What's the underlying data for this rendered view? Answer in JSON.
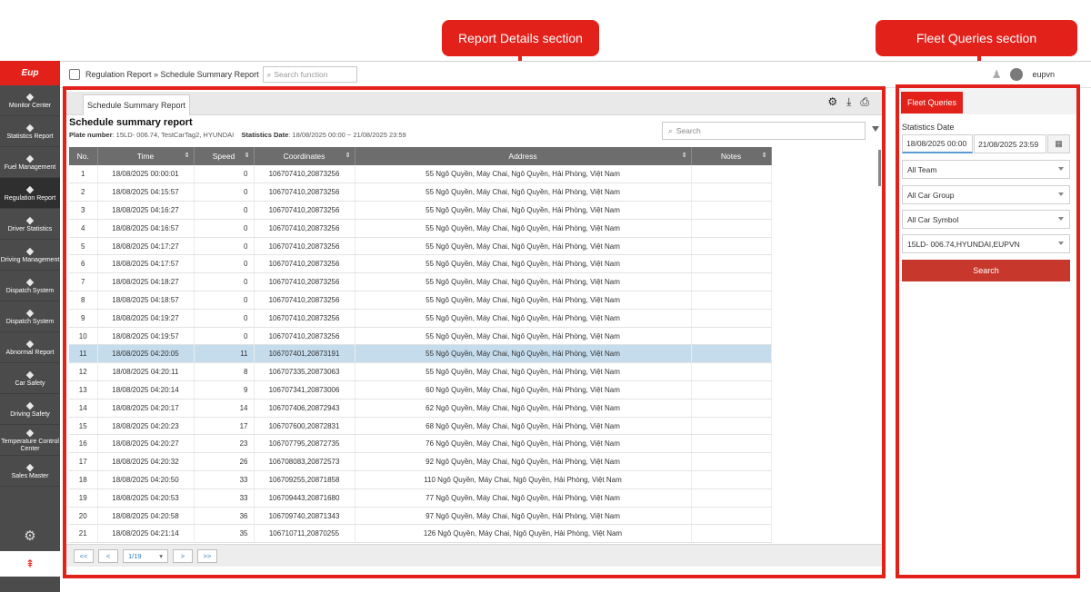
{
  "callouts": {
    "report_details": "Report Details section",
    "fleet_queries": "Fleet Queries section"
  },
  "sidebar": {
    "logo": "Eup",
    "items": [
      {
        "label": "Monitor Center",
        "icon": "monitor-icon"
      },
      {
        "label": "Statistics Report",
        "icon": "statistics-icon"
      },
      {
        "label": "Fuel Management",
        "icon": "fuel-icon"
      },
      {
        "label": "Regulation Report",
        "icon": "regulation-icon"
      },
      {
        "label": "Driver Statistics",
        "icon": "driver-icon"
      },
      {
        "label": "Driving Management",
        "icon": "driving-icon"
      },
      {
        "label": "Dispatch System",
        "icon": "dispatch-icon"
      },
      {
        "label": "Dispatch System",
        "icon": "dispatch-icon"
      },
      {
        "label": "Abnormal Report",
        "icon": "abnormal-icon"
      },
      {
        "label": "Car Safety",
        "icon": "car-safety-icon"
      },
      {
        "label": "Driving Safety",
        "icon": "driving-safety-icon"
      },
      {
        "label": "Temperature Control Center",
        "icon": "temperature-icon"
      },
      {
        "label": "Sales Master",
        "icon": "sales-icon"
      }
    ]
  },
  "topbar": {
    "breadcrumb": "Regulation Report » Schedule Summary Report",
    "search_placeholder": "Search function",
    "user": "eupvn"
  },
  "report": {
    "tab_label": "Schedule Summary Report",
    "title": "Schedule summary report",
    "plate_label": "Plate number",
    "plate_value": ": 15LD- 006.74, TestCarTag2, HYUNDAI",
    "date_label": "Statistics Date",
    "date_value": ": 18/08/2025 00:00 ~ 21/08/2025 23:59",
    "search_placeholder": "Search",
    "columns": [
      "No.",
      "Time",
      "Speed",
      "Coordinates",
      "Address",
      "Notes"
    ],
    "rows": [
      [
        "1",
        "18/08/2025 00:00:01",
        "0",
        "106707410,20873256",
        "55 Ngô Quyền, Máy Chai, Ngô Quyền, Hải Phòng, Việt Nam",
        ""
      ],
      [
        "2",
        "18/08/2025 04:15:57",
        "0",
        "106707410,20873256",
        "55 Ngô Quyền, Máy Chai, Ngô Quyền, Hải Phòng, Việt Nam",
        ""
      ],
      [
        "3",
        "18/08/2025 04:16:27",
        "0",
        "106707410,20873256",
        "55 Ngô Quyền, Máy Chai, Ngô Quyền, Hải Phòng, Việt Nam",
        ""
      ],
      [
        "4",
        "18/08/2025 04:16:57",
        "0",
        "106707410,20873256",
        "55 Ngô Quyền, Máy Chai, Ngô Quyền, Hải Phòng, Việt Nam",
        ""
      ],
      [
        "5",
        "18/08/2025 04:17:27",
        "0",
        "106707410,20873256",
        "55 Ngô Quyền, Máy Chai, Ngô Quyền, Hải Phòng, Việt Nam",
        ""
      ],
      [
        "6",
        "18/08/2025 04:17:57",
        "0",
        "106707410,20873256",
        "55 Ngô Quyền, Máy Chai, Ngô Quyền, Hải Phòng, Việt Nam",
        ""
      ],
      [
        "7",
        "18/08/2025 04:18:27",
        "0",
        "106707410,20873256",
        "55 Ngô Quyền, Máy Chai, Ngô Quyền, Hải Phòng, Việt Nam",
        ""
      ],
      [
        "8",
        "18/08/2025 04:18:57",
        "0",
        "106707410,20873256",
        "55 Ngô Quyền, Máy Chai, Ngô Quyền, Hải Phòng, Việt Nam",
        ""
      ],
      [
        "9",
        "18/08/2025 04:19:27",
        "0",
        "106707410,20873256",
        "55 Ngô Quyền, Máy Chai, Ngô Quyền, Hải Phòng, Việt Nam",
        ""
      ],
      [
        "10",
        "18/08/2025 04:19:57",
        "0",
        "106707410,20873256",
        "55 Ngô Quyền, Máy Chai, Ngô Quyền, Hải Phòng, Việt Nam",
        ""
      ],
      [
        "11",
        "18/08/2025 04:20:05",
        "11",
        "106707401,20873191",
        "55 Ngô Quyền, Máy Chai, Ngô Quyền, Hải Phòng, Việt Nam",
        ""
      ],
      [
        "12",
        "18/08/2025 04:20:11",
        "8",
        "106707335,20873063",
        "55 Ngô Quyền, Máy Chai, Ngô Quyền, Hải Phòng, Việt Nam",
        ""
      ],
      [
        "13",
        "18/08/2025 04:20:14",
        "9",
        "106707341,20873006",
        "60 Ngô Quyền, Máy Chai, Ngô Quyền, Hải Phòng, Việt Nam",
        ""
      ],
      [
        "14",
        "18/08/2025 04:20:17",
        "14",
        "106707406,20872943",
        "62 Ngô Quyền, Máy Chai, Ngô Quyền, Hải Phòng, Việt Nam",
        ""
      ],
      [
        "15",
        "18/08/2025 04:20:23",
        "17",
        "106707600,20872831",
        "68 Ngô Quyền, Máy Chai, Ngô Quyền, Hải Phòng, Việt Nam",
        ""
      ],
      [
        "16",
        "18/08/2025 04:20:27",
        "23",
        "106707795,20872735",
        "76 Ngô Quyền, Máy Chai, Ngô Quyền, Hải Phòng, Việt Nam",
        ""
      ],
      [
        "17",
        "18/08/2025 04:20:32",
        "26",
        "106708083,20872573",
        "92 Ngô Quyền, Máy Chai, Ngô Quyền, Hải Phòng, Việt Nam",
        ""
      ],
      [
        "18",
        "18/08/2025 04:20:50",
        "33",
        "106709255,20871858",
        "110 Ngô Quyền, Máy Chai, Ngô Quyền, Hải Phòng, Việt Nam",
        ""
      ],
      [
        "19",
        "18/08/2025 04:20:53",
        "33",
        "106709443,20871680",
        "77 Ngô Quyền, Máy Chai, Ngô Quyền, Hải Phòng, Việt Nam",
        ""
      ],
      [
        "20",
        "18/08/2025 04:20:58",
        "36",
        "106709740,20871343",
        "97 Ngô Quyền, Máy Chai, Ngô Quyền, Hải Phòng, Việt Nam",
        ""
      ],
      [
        "21",
        "18/08/2025 04:21:14",
        "35",
        "106710711,20870255",
        "126 Ngô Quyền, Máy Chai, Ngô Quyền, Hải Phòng, Việt Nam",
        ""
      ]
    ],
    "selected_row": "11",
    "pager": {
      "first": "<<",
      "prev": "<",
      "page": "1/19",
      "next": ">",
      "last": ">>"
    }
  },
  "fleet": {
    "tab": "Fleet Queries",
    "date_label": "Statistics Date",
    "date_from": "18/08/2025 00:00",
    "date_to": "21/08/2025 23:59",
    "team": "All Team",
    "car_group": "All Car Group",
    "car_symbol": "All Car Symbol",
    "vehicle": "15LD- 006.74,HYUNDAI,EUPVN",
    "search_button": "Search"
  },
  "colors": {
    "accent": "#e3211b",
    "header": "#6d6d6d",
    "selected_row": "#c5dcec",
    "sidebar": "#4b4b4b"
  }
}
